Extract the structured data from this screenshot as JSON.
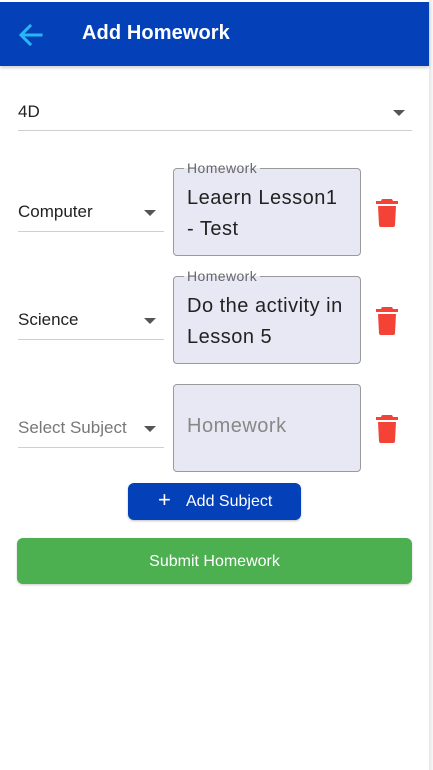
{
  "header": {
    "title": "Add Homework",
    "back_icon": "back-arrow-icon",
    "background_color": "#0440b8",
    "icon_color": "#29b6f6"
  },
  "class_select": {
    "value": "4D"
  },
  "rows": [
    {
      "subject": "Computer",
      "homework_label": "Homework",
      "homework_value": "Leaern Lesson1 - Test"
    },
    {
      "subject": "Science",
      "homework_label": "Homework",
      "homework_value": "Do the activity in Lesson 5"
    },
    {
      "subject_placeholder": "Select Subject",
      "homework_placeholder": "Homework"
    }
  ],
  "actions": {
    "add_subject": "Add Subject",
    "submit": "Submit Homework",
    "add_color": "#0440b8",
    "submit_color": "#4caf50",
    "delete_color": "#f44336"
  }
}
